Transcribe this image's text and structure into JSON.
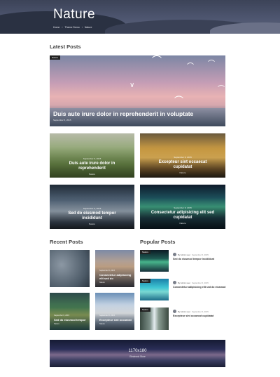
{
  "hero": {
    "title": "Nature",
    "breadcrumbs": [
      "Home",
      "Theme Demo",
      "Nature"
    ]
  },
  "sections": {
    "latest": "Latest Posts",
    "recent": "Recent Posts",
    "popular": "Popular Posts"
  },
  "featured": {
    "badge": "Nature",
    "title": "Duis aute irure dolor in reprehenderit in voluptate",
    "date": "September 6, 2015"
  },
  "grid": [
    {
      "date": "September 6, 2015",
      "title": "Duis aute irure dolor in reprehenderit",
      "more": "Nature"
    },
    {
      "date": "September 6, 2015",
      "title": "Excepteur sint occaecat cupidatat",
      "more": "Nature"
    },
    {
      "date": "September 6, 2015",
      "title": "Sed do eiusmod tempor incididunt",
      "more": "Nature"
    },
    {
      "date": "September 6, 2015",
      "title": "Consectetur adipisicing elit sed cupidatat",
      "more": "Nature"
    }
  ],
  "recent": [
    {
      "date": "",
      "title": "",
      "more": ""
    },
    {
      "date": "September 6, 2015",
      "title": "Consectetur adipisicing elit sed do",
      "more": "Nature"
    },
    {
      "date": "September 6, 2015",
      "title": "Sed do eiusmod tempor",
      "more": "Nature"
    },
    {
      "date": "September 6, 2015",
      "title": "Excepteur sint occaecat",
      "more": "Nature"
    }
  ],
  "popular": [
    {
      "badge": "Nature",
      "author": "By Admin user",
      "date": "September 6, 2015",
      "title": "Sed do eiusmod tempor incididunt"
    },
    {
      "badge": "Nature",
      "author": "By Admin user",
      "date": "September 6, 2015",
      "title": "Consectetur adipisicing elit sed do eiusmod"
    },
    {
      "badge": "Nature",
      "author": "By Admin user",
      "date": "September 6, 2015",
      "title": "Excepteur sint occaecat cupidatat"
    }
  ],
  "banner": {
    "size": "1170x180",
    "sub": "Electronic Store"
  }
}
